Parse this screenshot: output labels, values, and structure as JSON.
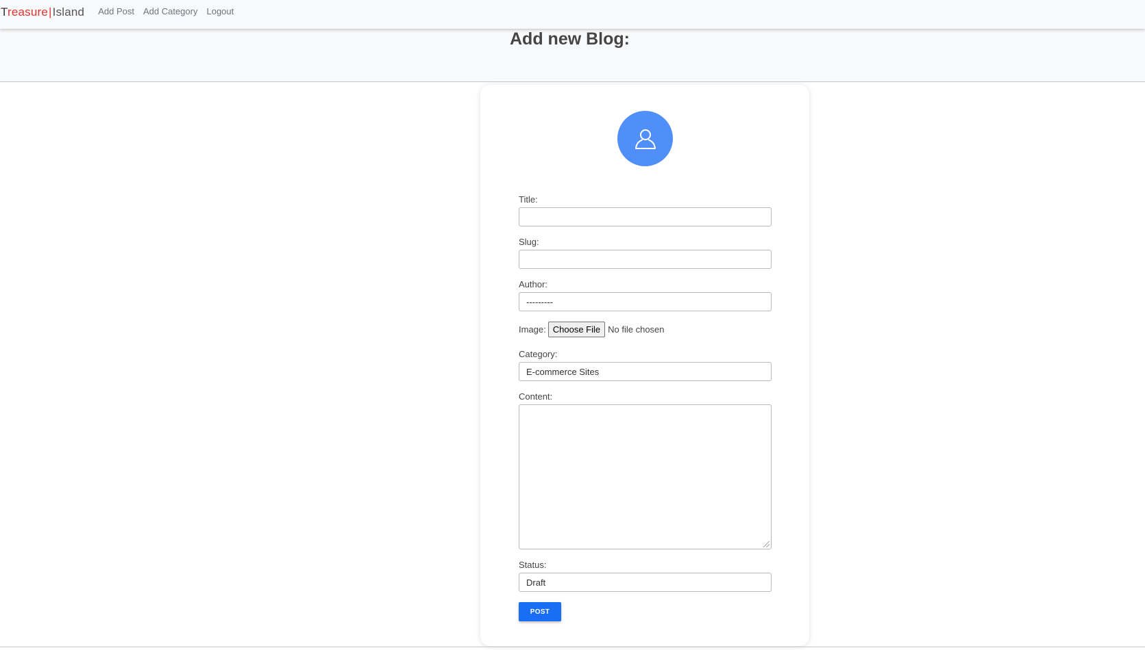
{
  "navbar": {
    "brand": {
      "part1": "T",
      "part2": "reasure",
      "sep": "|",
      "part3": "Island"
    },
    "links": [
      "Add Post",
      "Add Category",
      "Logout"
    ]
  },
  "page": {
    "title": "Add new Blog:"
  },
  "form": {
    "title_label": "Title:",
    "title_value": "",
    "slug_label": "Slug:",
    "slug_value": "",
    "author_label": "Author:",
    "author_value": "---------",
    "image_label": "Image:",
    "file_button": "Choose File",
    "file_status": "No file chosen",
    "category_label": "Category:",
    "category_value": "E-commerce Sites",
    "content_label": "Content:",
    "content_value": "",
    "status_label": "Status:",
    "status_value": "Draft",
    "submit_label": "POST"
  },
  "colors": {
    "accent": "#1a6ef5",
    "avatar": "#4f8ff7",
    "brand_red": "#e2342f"
  },
  "icons": {
    "avatar": "user-icon"
  }
}
